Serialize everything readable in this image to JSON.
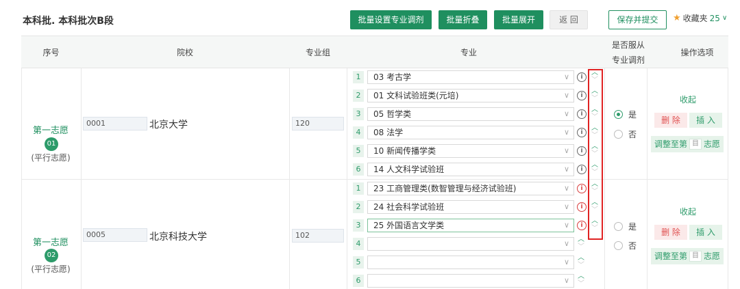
{
  "header": {
    "title": "本科批. 本科批次B段",
    "btn_batch_adjust": "批量设置专业调剂",
    "btn_collapse_all": "批量折叠",
    "btn_expand_all": "批量展开",
    "btn_back": "返 回",
    "btn_save_submit": "保存并提交",
    "favorites_label": "收藏夹",
    "favorites_count": "25"
  },
  "columns": {
    "index": "序号",
    "school": "院校",
    "group": "专业组",
    "major": "专业",
    "adjust_line1": "是否服从",
    "adjust_line2": "专业调剂",
    "ops": "操作选项"
  },
  "rows": [
    {
      "volunteer": "第一志愿",
      "badge": "01",
      "type": "(平行志愿)",
      "school_code": "0001",
      "school_name": "北京大学",
      "group_code": "120",
      "majors": [
        {
          "num": "1",
          "label": "03  考古学"
        },
        {
          "num": "2",
          "label": "01  文科试验班类(元培)"
        },
        {
          "num": "3",
          "label": "05  哲学类"
        },
        {
          "num": "4",
          "label": "08  法学"
        },
        {
          "num": "5",
          "label": "10  新闻传播学类"
        },
        {
          "num": "6",
          "label": "14  人文科学试验班"
        }
      ],
      "adjust_yes": "是",
      "adjust_no": "否",
      "op_collapse": "收起",
      "op_delete": "删 除",
      "op_insert": "插 入",
      "op_move_prefix": "调整至第",
      "op_move_suffix": "志愿",
      "op_move_placeholder": "目"
    },
    {
      "volunteer": "第一志愿",
      "badge": "02",
      "type": "(平行志愿)",
      "school_code": "0005",
      "school_name": "北京科技大学",
      "group_code": "102",
      "majors": [
        {
          "num": "1",
          "label": "23  工商管理类(数智管理与经济试验班)"
        },
        {
          "num": "2",
          "label": "24  社会科学试验班"
        },
        {
          "num": "3",
          "label": "25  外国语言文学类"
        },
        {
          "num": "4",
          "label": ""
        },
        {
          "num": "5",
          "label": ""
        },
        {
          "num": "6",
          "label": ""
        }
      ],
      "adjust_yes": "是",
      "adjust_no": "否",
      "op_collapse": "收起",
      "op_delete": "删 除",
      "op_insert": "插 入",
      "op_move_prefix": "调整至第",
      "op_move_suffix": "志愿",
      "op_move_placeholder": "目"
    }
  ],
  "icons": {
    "info": "i",
    "star": "★",
    "chevron_down": "∨",
    "arrow_up": "︿",
    "arrow_down": "﹀"
  },
  "colors": {
    "accent": "#1f8f5f",
    "danger": "#e05252",
    "highlight_frame": "#e02222"
  }
}
